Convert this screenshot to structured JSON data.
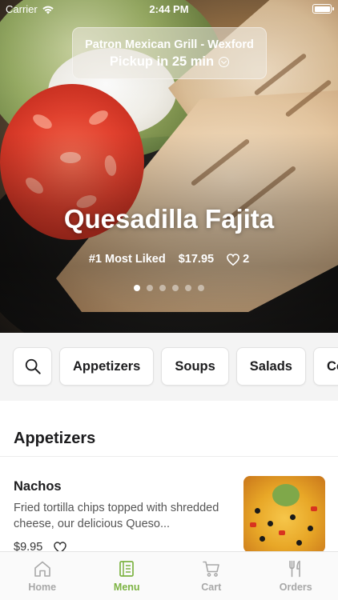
{
  "status_bar": {
    "carrier": "Carrier",
    "time": "2:44 PM"
  },
  "header": {
    "store_name": "Patron Mexican Grill - Wexford",
    "pickup": "Pickup in 25 min"
  },
  "featured": {
    "title": "Quesadilla Fajita",
    "rank": "#1 Most Liked",
    "price": "$17.95",
    "likes": "2",
    "slides": 6,
    "active_slide": 1
  },
  "categories": [
    "Appetizers",
    "Soups",
    "Salads",
    "Co"
  ],
  "menu": {
    "section_title": "Appetizers",
    "items": [
      {
        "name": "Nachos",
        "description": "Fried tortilla chips topped with shredded cheese, our delicious Queso...",
        "price": "$9.95"
      }
    ]
  },
  "tabs": [
    {
      "label": "Home",
      "icon": "home-icon",
      "active": false
    },
    {
      "label": "Menu",
      "icon": "menu-icon",
      "active": true
    },
    {
      "label": "Cart",
      "icon": "cart-icon",
      "active": false
    },
    {
      "label": "Orders",
      "icon": "orders-icon",
      "active": false
    }
  ],
  "colors": {
    "accent": "#7cb342",
    "inactive_tab": "#a8a8a8",
    "category_bar_bg": "#f4f4f4"
  }
}
